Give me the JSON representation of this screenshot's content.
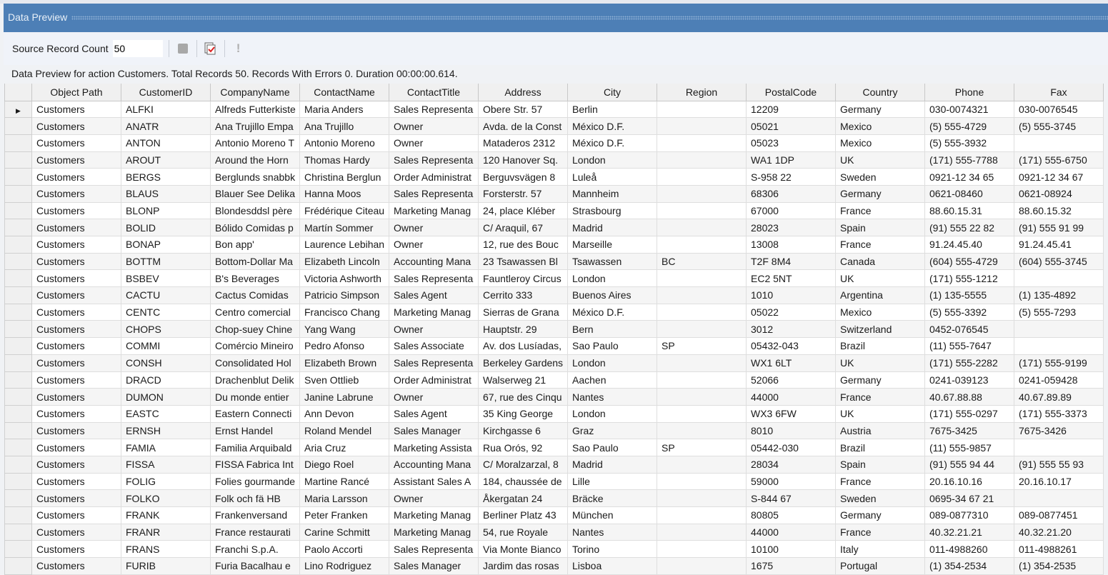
{
  "panel": {
    "title": "Data Preview"
  },
  "toolbar": {
    "source_count_label": "Source Record Count",
    "source_count_value": "50"
  },
  "status": "Data Preview for action Customers. Total Records 50. Records With Errors 0. Duration 00:00:00.614.",
  "grid": {
    "columns": [
      "Object Path",
      "CustomerID",
      "CompanyName",
      "ContactName",
      "ContactTitle",
      "Address",
      "City",
      "Region",
      "PostalCode",
      "Country",
      "Phone",
      "Fax"
    ],
    "rows": [
      [
        "Customers",
        "ALFKI",
        "Alfreds Futterkiste",
        "Maria Anders",
        "Sales Representa",
        "Obere Str. 57",
        "Berlin",
        "",
        "12209",
        "Germany",
        "030-0074321",
        "030-0076545"
      ],
      [
        "Customers",
        "ANATR",
        "Ana Trujillo Empa",
        "Ana Trujillo",
        "Owner",
        "Avda. de la Const",
        "México D.F.",
        "",
        "05021",
        "Mexico",
        "(5) 555-4729",
        "(5) 555-3745"
      ],
      [
        "Customers",
        "ANTON",
        "Antonio Moreno T",
        "Antonio Moreno",
        "Owner",
        "Mataderos  2312",
        "México D.F.",
        "",
        "05023",
        "Mexico",
        "(5) 555-3932",
        ""
      ],
      [
        "Customers",
        "AROUT",
        "Around the Horn",
        "Thomas Hardy",
        "Sales Representa",
        "120 Hanover Sq.",
        "London",
        "",
        "WA1 1DP",
        "UK",
        "(171) 555-7788",
        "(171) 555-6750"
      ],
      [
        "Customers",
        "BERGS",
        "Berglunds snabbk",
        "Christina Berglun",
        "Order Administrat",
        "Berguvsvägen  8",
        "Luleå",
        "",
        "S-958 22",
        "Sweden",
        "0921-12 34 65",
        "0921-12 34 67"
      ],
      [
        "Customers",
        "BLAUS",
        "Blauer See Delika",
        "Hanna Moos",
        "Sales Representa",
        "Forsterstr. 57",
        "Mannheim",
        "",
        "68306",
        "Germany",
        "0621-08460",
        "0621-08924"
      ],
      [
        "Customers",
        "BLONP",
        "Blondesddsl père",
        "Frédérique Citeau",
        "Marketing Manag",
        "24, place Kléber",
        "Strasbourg",
        "",
        "67000",
        "France",
        "88.60.15.31",
        "88.60.15.32"
      ],
      [
        "Customers",
        "BOLID",
        "Bólido Comidas p",
        "Martín Sommer",
        "Owner",
        "C/ Araquil, 67",
        "Madrid",
        "",
        "28023",
        "Spain",
        "(91) 555 22 82",
        "(91) 555 91 99"
      ],
      [
        "Customers",
        "BONAP",
        "Bon app'",
        "Laurence Lebihan",
        "Owner",
        "12, rue des Bouc",
        "Marseille",
        "",
        "13008",
        "France",
        "91.24.45.40",
        "91.24.45.41"
      ],
      [
        "Customers",
        "BOTTM",
        "Bottom-Dollar Ma",
        "Elizabeth Lincoln",
        "Accounting Mana",
        "23 Tsawassen Bl",
        "Tsawassen",
        "BC",
        "T2F 8M4",
        "Canada",
        "(604) 555-4729",
        "(604) 555-3745"
      ],
      [
        "Customers",
        "BSBEV",
        "B's Beverages",
        "Victoria Ashworth",
        "Sales Representa",
        "Fauntleroy Circus",
        "London",
        "",
        "EC2 5NT",
        "UK",
        "(171) 555-1212",
        ""
      ],
      [
        "Customers",
        "CACTU",
        "Cactus Comidas",
        "Patricio Simpson",
        "Sales Agent",
        "Cerrito 333",
        "Buenos Aires",
        "",
        "1010",
        "Argentina",
        "(1) 135-5555",
        "(1) 135-4892"
      ],
      [
        "Customers",
        "CENTC",
        "Centro comercial",
        "Francisco Chang",
        "Marketing Manag",
        "Sierras de Grana",
        "México D.F.",
        "",
        "05022",
        "Mexico",
        "(5) 555-3392",
        "(5) 555-7293"
      ],
      [
        "Customers",
        "CHOPS",
        "Chop-suey Chine",
        "Yang Wang",
        "Owner",
        "Hauptstr. 29",
        "Bern",
        "",
        "3012",
        "Switzerland",
        "0452-076545",
        ""
      ],
      [
        "Customers",
        "COMMI",
        "Comércio Mineiro",
        "Pedro Afonso",
        "Sales Associate",
        "Av. dos Lusíadas,",
        "Sao Paulo",
        "SP",
        "05432-043",
        "Brazil",
        "(11) 555-7647",
        ""
      ],
      [
        "Customers",
        "CONSH",
        "Consolidated Hol",
        "Elizabeth Brown",
        "Sales Representa",
        "Berkeley Gardens",
        "London",
        "",
        "WX1 6LT",
        "UK",
        "(171) 555-2282",
        "(171) 555-9199"
      ],
      [
        "Customers",
        "DRACD",
        "Drachenblut Delik",
        "Sven Ottlieb",
        "Order Administrat",
        "Walserweg 21",
        "Aachen",
        "",
        "52066",
        "Germany",
        "0241-039123",
        "0241-059428"
      ],
      [
        "Customers",
        "DUMON",
        "Du monde entier",
        "Janine Labrune",
        "Owner",
        "67, rue des Cinqu",
        "Nantes",
        "",
        "44000",
        "France",
        "40.67.88.88",
        "40.67.89.89"
      ],
      [
        "Customers",
        "EASTC",
        "Eastern Connecti",
        "Ann Devon",
        "Sales Agent",
        "35 King George",
        "London",
        "",
        "WX3 6FW",
        "UK",
        "(171) 555-0297",
        "(171) 555-3373"
      ],
      [
        "Customers",
        "ERNSH",
        "Ernst Handel",
        "Roland Mendel",
        "Sales Manager",
        "Kirchgasse 6",
        "Graz",
        "",
        "8010",
        "Austria",
        "7675-3425",
        "7675-3426"
      ],
      [
        "Customers",
        "FAMIA",
        "Familia Arquibald",
        "Aria Cruz",
        "Marketing Assista",
        "Rua Orós, 92",
        "Sao Paulo",
        "SP",
        "05442-030",
        "Brazil",
        "(11) 555-9857",
        ""
      ],
      [
        "Customers",
        "FISSA",
        "FISSA Fabrica Int",
        "Diego Roel",
        "Accounting Mana",
        "C/ Moralzarzal, 8",
        "Madrid",
        "",
        "28034",
        "Spain",
        "(91) 555 94 44",
        "(91) 555 55 93"
      ],
      [
        "Customers",
        "FOLIG",
        "Folies gourmande",
        "Martine Rancé",
        "Assistant Sales A",
        "184, chaussée de",
        "Lille",
        "",
        "59000",
        "France",
        "20.16.10.16",
        "20.16.10.17"
      ],
      [
        "Customers",
        "FOLKO",
        "Folk och fä HB",
        "Maria Larsson",
        "Owner",
        "Åkergatan 24",
        "Bräcke",
        "",
        "S-844 67",
        "Sweden",
        "0695-34 67 21",
        ""
      ],
      [
        "Customers",
        "FRANK",
        "Frankenversand",
        "Peter Franken",
        "Marketing Manag",
        "Berliner Platz 43",
        "München",
        "",
        "80805",
        "Germany",
        "089-0877310",
        "089-0877451"
      ],
      [
        "Customers",
        "FRANR",
        "France restaurati",
        "Carine Schmitt",
        "Marketing Manag",
        "54, rue Royale",
        "Nantes",
        "",
        "44000",
        "France",
        "40.32.21.21",
        "40.32.21.20"
      ],
      [
        "Customers",
        "FRANS",
        "Franchi S.p.A.",
        "Paolo Accorti",
        "Sales Representa",
        "Via Monte Bianco",
        "Torino",
        "",
        "10100",
        "Italy",
        "011-4988260",
        "011-4988261"
      ],
      [
        "Customers",
        "FURIB",
        "Furia Bacalhau e",
        "Lino Rodriguez",
        "Sales Manager",
        "Jardim das rosas",
        "Lisboa",
        "",
        "1675",
        "Portugal",
        "(1) 354-2534",
        "(1) 354-2535"
      ]
    ]
  }
}
